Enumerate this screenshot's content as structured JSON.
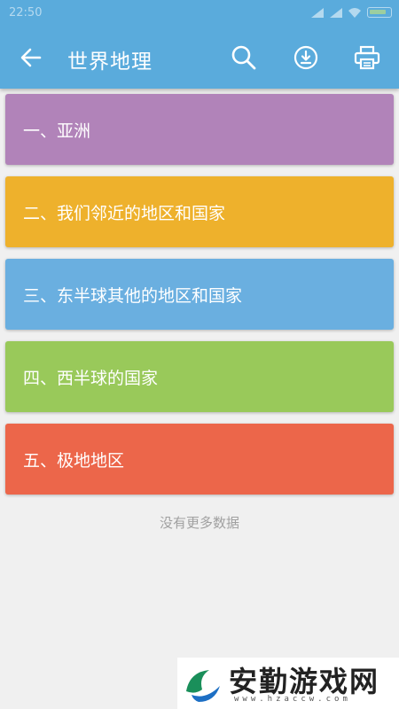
{
  "status_bar": {
    "time": "22:50"
  },
  "toolbar": {
    "title": "世界地理",
    "back_icon": "arrow-left-icon",
    "search_icon": "search-icon",
    "download_icon": "download-icon",
    "print_icon": "printer-icon",
    "background_color": "#5aabdc"
  },
  "list": {
    "items": [
      {
        "label": "一、亚洲",
        "color": "#b183b9"
      },
      {
        "label": "二、我们邻近的地区和国家",
        "color": "#eeb12c"
      },
      {
        "label": "三、东半球其他的地区和国家",
        "color": "#6aafe0"
      },
      {
        "label": "四、西半球的国家",
        "color": "#99c95a"
      },
      {
        "label": "五、极地地区",
        "color": "#ec664a"
      }
    ],
    "end_text": "没有更多数据"
  },
  "watermark": {
    "text": "安勤游戏网",
    "url": "www.hzaccw.com"
  }
}
